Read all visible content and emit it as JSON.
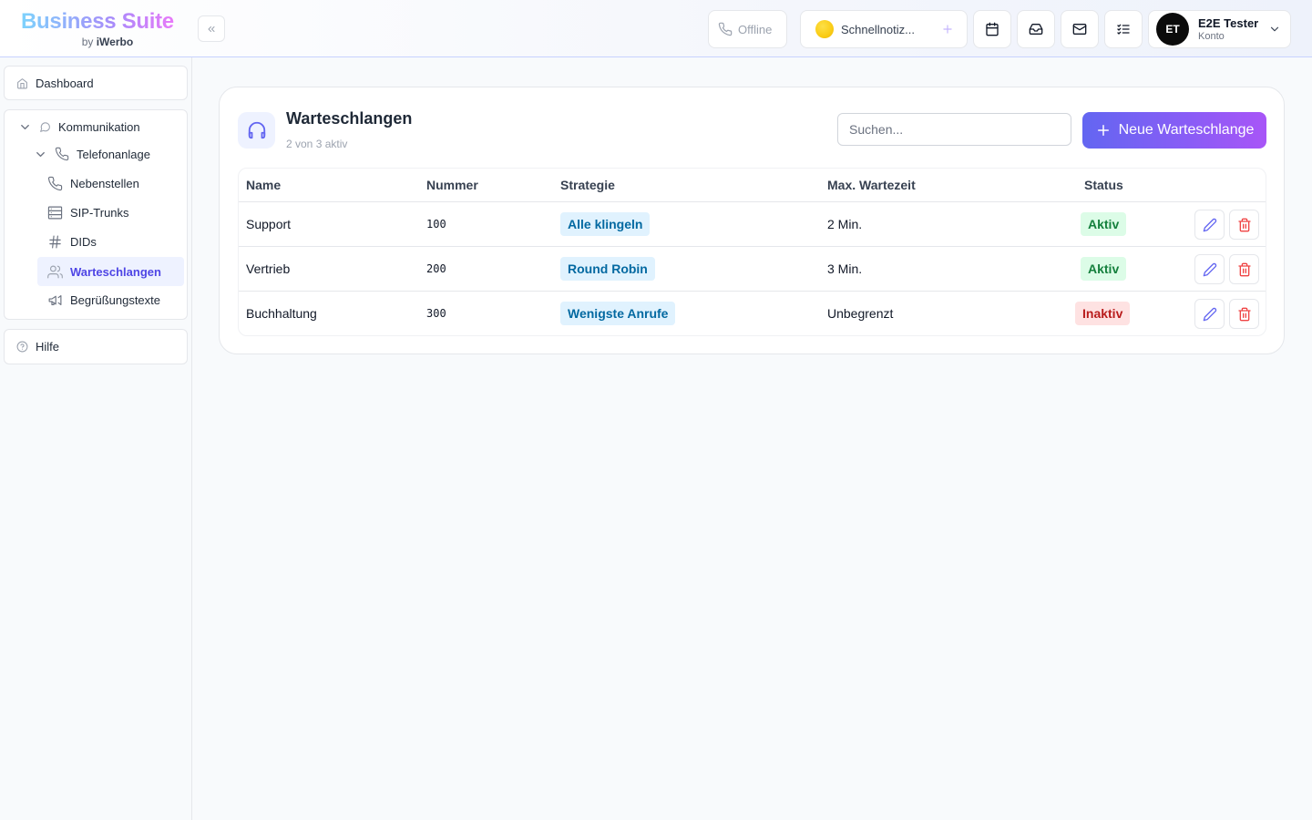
{
  "app": {
    "title": "Business Suite",
    "by": "by",
    "company": "iWerbo"
  },
  "header": {
    "status_label": "Offline",
    "notes_placeholder": "Schnellnotiz...",
    "user": {
      "initials": "ET",
      "name": "E2E Tester",
      "sub": "Konto"
    }
  },
  "sidebar": {
    "dashboard": "Dashboard",
    "communication": "Kommunikation",
    "phone_system": "Telefonanlage",
    "items": [
      "Nebenstellen",
      "SIP-Trunks",
      "DIDs",
      "Warteschlangen",
      "Begrüßungstexte"
    ],
    "help": "Hilfe"
  },
  "main": {
    "title": "Warteschlangen",
    "subtitle": "2 von 3 aktiv",
    "search_placeholder": "Suchen...",
    "new_button": "Neue Warteschlange",
    "columns": {
      "name": "Name",
      "number": "Nummer",
      "strategy": "Strategie",
      "max_wait": "Max. Wartezeit",
      "status": "Status"
    },
    "rows": [
      {
        "name": "Support",
        "number": "100",
        "strategy": "Alle klingeln",
        "max_wait": "2 Min.",
        "status": "Aktiv",
        "active": true
      },
      {
        "name": "Vertrieb",
        "number": "200",
        "strategy": "Round Robin",
        "max_wait": "3 Min.",
        "status": "Aktiv",
        "active": true
      },
      {
        "name": "Buchhaltung",
        "number": "300",
        "strategy": "Wenigste Anrufe",
        "max_wait": "Unbegrenzt",
        "status": "Inaktiv",
        "active": false
      }
    ]
  },
  "colors": {
    "accent": "#4f46e5",
    "active": "#15803d",
    "inactive": "#b91c1c",
    "strategy": "#0369a1"
  }
}
